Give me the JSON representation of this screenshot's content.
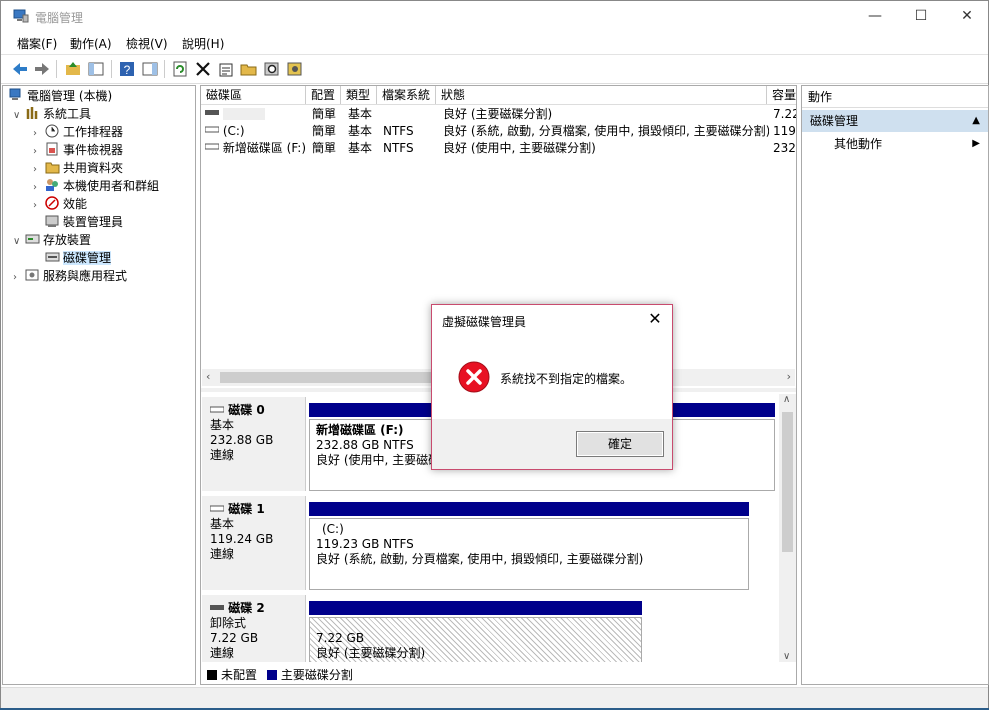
{
  "window": {
    "title": "電腦管理"
  },
  "menu": [
    "檔案(F)",
    "動作(A)",
    "檢視(V)",
    "說明(H)"
  ],
  "tree": {
    "root": "電腦管理 (本機)",
    "system_tools": "系統工具",
    "task_scheduler": "工作排程器",
    "event_viewer": "事件檢視器",
    "shared_folders": "共用資料夾",
    "local_users": "本機使用者和群組",
    "performance": "效能",
    "device_manager": "裝置管理員",
    "storage": "存放裝置",
    "disk_management": "磁碟管理",
    "services_apps": "服務與應用程式"
  },
  "volumes": {
    "headers": [
      "磁碟區",
      "配置",
      "類型",
      "檔案系統",
      "狀態",
      "容量"
    ],
    "rows": [
      [
        "",
        "簡單",
        "基本",
        "",
        "良好 (主要磁碟分割)",
        "7.22"
      ],
      [
        "(C:)",
        "簡單",
        "基本",
        "NTFS",
        "良好 (系統, 啟動, 分頁檔案, 使用中, 損毀傾印, 主要磁碟分割)",
        "119."
      ],
      [
        "新增磁碟區 (F:)",
        "簡單",
        "基本",
        "NTFS",
        "良好 (使用中, 主要磁碟分割)",
        "232."
      ]
    ]
  },
  "disks": [
    {
      "name": "磁碟 0",
      "type": "基本",
      "size": "232.88 GB",
      "status": "連線",
      "part_name": "新增磁碟區  (F:)",
      "part_size": "232.88 GB NTFS",
      "part_status": "良好 (使用中, 主要磁碟"
    },
    {
      "name": "磁碟 1",
      "type": "基本",
      "size": "119.24 GB",
      "status": "連線",
      "part_name": "(C:)",
      "part_size": "119.23 GB NTFS",
      "part_status": "良好 (系統, 啟動, 分頁檔案, 使用中, 損毀傾印, 主要磁碟分割)"
    },
    {
      "name": "磁碟 2",
      "type": "卸除式",
      "size": "7.22 GB",
      "status": "連線",
      "part_name": "",
      "part_size": "7.22 GB",
      "part_status": "良好 (主要磁碟分割)"
    }
  ],
  "legend": {
    "unallocated": "未配置",
    "primary": "主要磁碟分割"
  },
  "actions": {
    "title": "動作",
    "section": "磁碟管理",
    "more": "其他動作"
  },
  "dialog": {
    "title": "虛擬磁碟管理員",
    "message": "系統找不到指定的檔案。",
    "ok": "確定"
  },
  "colors": {
    "partition_bar": "#00008b",
    "selection": "#cde8ff",
    "action_section": "#cfe0ef",
    "error_red": "#e81123"
  }
}
